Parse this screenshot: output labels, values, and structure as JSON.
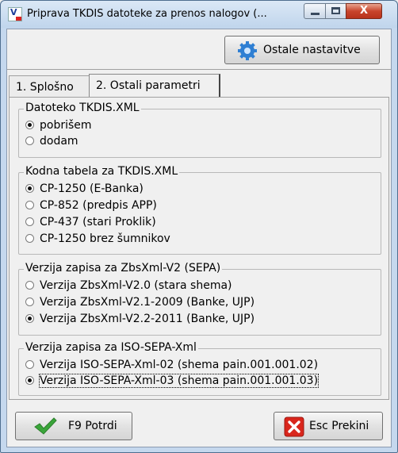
{
  "window": {
    "title": "Priprava TKDIS datoteke za prenos nalogov  (...",
    "close_glyph": "X",
    "app_icon_letter": "V"
  },
  "toolbar": {
    "other_settings_label": "Ostale nastavitve"
  },
  "tabs": [
    {
      "label": "1. Splošno",
      "selected": false
    },
    {
      "label": "2. Ostali parametri",
      "selected": true
    }
  ],
  "groups": {
    "datoteko": {
      "title": "Datoteko TKDIS.XML",
      "options": [
        {
          "label": "pobrišem",
          "checked": true
        },
        {
          "label": "dodam",
          "checked": false
        }
      ]
    },
    "kodna": {
      "title": "Kodna tabela za TKDIS.XML",
      "options": [
        {
          "label": "CP-1250 (E-Banka)",
          "checked": true
        },
        {
          "label": "CP-852 (predpis APP)",
          "checked": false
        },
        {
          "label": "CP-437 (stari Proklik)",
          "checked": false
        },
        {
          "label": "CP-1250 brez šumnikov",
          "checked": false
        }
      ]
    },
    "zbs": {
      "title": "Verzija zapisa za ZbsXml-V2 (SEPA)",
      "options": [
        {
          "label": "Verzija ZbsXml-V2.0 (stara shema)",
          "checked": false
        },
        {
          "label": "Verzija ZbsXml-V2.1-2009 (Banke, UJP)",
          "checked": false
        },
        {
          "label": "Verzija ZbsXml-V2.2-2011 (Banke, UJP)",
          "checked": true
        }
      ]
    },
    "iso": {
      "title": "Verzija zapisa za ISO-SEPA-Xml",
      "options": [
        {
          "label": "Verzija ISO-SEPA-Xml-02 (shema pain.001.001.02)",
          "checked": false
        },
        {
          "label": "Verzija ISO-SEPA-Xml-03 (shema pain.001.001.03)",
          "checked": true
        }
      ]
    }
  },
  "buttons": {
    "confirm_label": "F9 Potrdi",
    "cancel_label": "Esc Prekini"
  },
  "colors": {
    "check_green": "#3aa53a",
    "cancel_red": "#d9261c",
    "gear_blue": "#2f7fd3"
  }
}
